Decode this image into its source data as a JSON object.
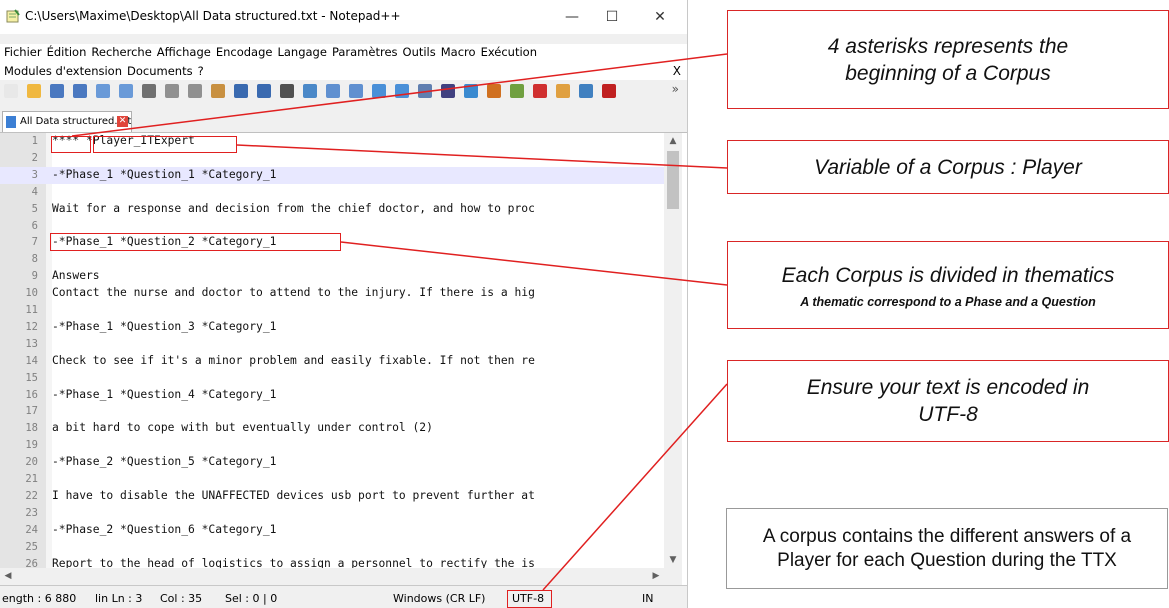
{
  "window": {
    "title": "C:\\Users\\Maxime\\Desktop\\All Data structured.txt - Notepad++",
    "minimize": "—",
    "maximize": "☐",
    "close": "✕"
  },
  "menu": {
    "row1": [
      "Fichier",
      "Édition",
      "Recherche",
      "Affichage",
      "Encodage",
      "Langage",
      "Paramètres",
      "Outils",
      "Macro",
      "Exécution"
    ],
    "row2": [
      "Modules d'extension",
      "Documents",
      "?"
    ],
    "close": "X"
  },
  "toolbar": {
    "icons": [
      "new-file-icon",
      "open-icon",
      "save-icon",
      "save-all-icon",
      "close-icon",
      "close-all-icon",
      "print-icon",
      "cut-icon",
      "copy-icon",
      "paste-icon",
      "undo-icon",
      "redo-icon",
      "find-icon",
      "replace-icon",
      "zoom-in-icon",
      "zoom-out-icon",
      "sync-v-icon",
      "sync-h-icon",
      "word-wrap-icon",
      "show-all-icon",
      "indent-guide-icon",
      "lang-icon",
      "doc-map-icon",
      "function-list-icon",
      "folder-icon",
      "monitor-icon",
      "record-macro-icon"
    ],
    "more": "»"
  },
  "tab": {
    "label": "All Data structured.txt",
    "close": "✕"
  },
  "editor": {
    "lines": [
      {
        "n": "1",
        "text": "**** *Player_ITExpert"
      },
      {
        "n": "2",
        "text": ""
      },
      {
        "n": "3",
        "text": "-*Phase_1 *Question_1 *Category_1"
      },
      {
        "n": "4",
        "text": ""
      },
      {
        "n": "5",
        "text": "Wait for a response and decision from the chief doctor, and how to proc"
      },
      {
        "n": "6",
        "text": ""
      },
      {
        "n": "7",
        "text": "-*Phase_1 *Question_2 *Category_1"
      },
      {
        "n": "8",
        "text": ""
      },
      {
        "n": "9",
        "text": "Answers"
      },
      {
        "n": "10",
        "text": "Contact the nurse and doctor to attend to the injury. If there is a hig"
      },
      {
        "n": "11",
        "text": ""
      },
      {
        "n": "12",
        "text": "-*Phase_1 *Question_3 *Category_1"
      },
      {
        "n": "13",
        "text": ""
      },
      {
        "n": "14",
        "text": "Check to see if it's a minor problem and easily fixable. If not then re"
      },
      {
        "n": "15",
        "text": ""
      },
      {
        "n": "16",
        "text": "-*Phase_1 *Question_4 *Category_1"
      },
      {
        "n": "17",
        "text": ""
      },
      {
        "n": "18",
        "text": "a bit hard to cope with but eventually under control (2)"
      },
      {
        "n": "19",
        "text": ""
      },
      {
        "n": "20",
        "text": "-*Phase_2 *Question_5 *Category_1"
      },
      {
        "n": "21",
        "text": ""
      },
      {
        "n": "22",
        "text": "I have to disable the UNAFFECTED devices usb port to prevent further at"
      },
      {
        "n": "23",
        "text": ""
      },
      {
        "n": "24",
        "text": "-*Phase_2 *Question_6 *Category_1"
      },
      {
        "n": "25",
        "text": ""
      },
      {
        "n": "26",
        "text": "Report to the head of logistics to assign a personnel to rectify the is"
      }
    ]
  },
  "status": {
    "length": "ength : 6 880",
    "lines": "lin Ln : 3",
    "col": "Col : 35",
    "sel": "Sel : 0 | 0",
    "eol": "Windows (CR LF)",
    "encoding": "UTF-8",
    "mode": "IN"
  },
  "callouts": {
    "asterisks": "4 asterisks represents the beginning of a Corpus",
    "variable": "Variable of a Corpus : Player",
    "thematics": "Each Corpus is divided in thematics",
    "thematics_sub": "A thematic correspond to a Phase and a Question",
    "encoding": "Ensure your text is encoded in UTF-8",
    "note": "A corpus contains the different answers of a Player for each Question during the TTX"
  },
  "colors": {
    "accent_red": "#e02020",
    "current_line": "#e8e8ff",
    "gutter": "#e4e4e4"
  }
}
